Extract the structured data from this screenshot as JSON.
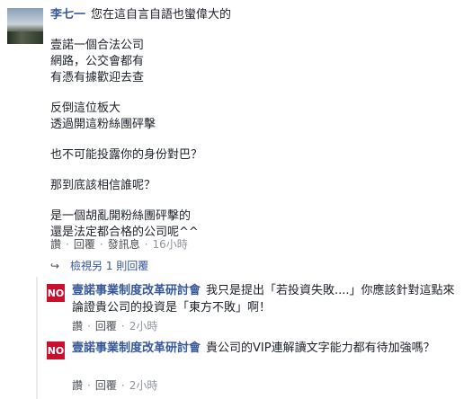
{
  "comment": {
    "author": "李七一",
    "lines": [
      "您在這自言自語也蠻偉大的",
      "壹諾一個合法公司\n網路，公交會都有\n有憑有據歡迎去查",
      "反倒這位板大\n透過開這粉絲團砰擊",
      "也不可能投露你的身份對巴？",
      "那到底該相信誰呢？",
      "是一個胡亂開粉絲團砰擊的\n還是法定都合格的公司呢^^"
    ],
    "actions": {
      "like": "讚",
      "reply": "回覆",
      "sent": "發訊息",
      "time": "16小時"
    }
  },
  "view_replies": "檢視另 1 則回覆",
  "replies": [
    {
      "avatar_text": "NO",
      "author": "壹諾事業制度改革研討會",
      "text": "我只是提出「若投資失敗....」你應該針對這點來論證貴公司的投資是「東方不敗」啊！",
      "actions": {
        "like": "讚",
        "reply": "回覆",
        "time": "2小時"
      }
    },
    {
      "avatar_text": "NO",
      "author": "壹諾事業制度改革研討會",
      "text": "貴公司的VIP連解讀文字能力都有待加強嗎？",
      "actions": {
        "like": "讚",
        "reply": "回覆",
        "time": "2小時"
      }
    }
  ]
}
